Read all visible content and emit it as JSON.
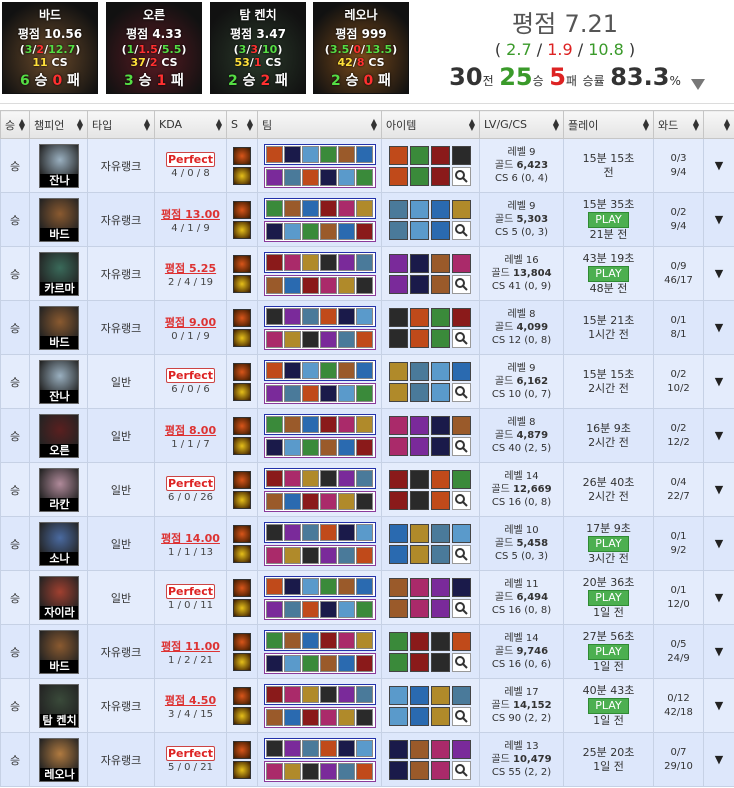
{
  "top_cards": [
    {
      "name": "바드",
      "rating": "평점 10.56",
      "k": "3",
      "d": "2",
      "a": "12.7",
      "cs": "11",
      "wins": "6",
      "losses": "0",
      "bg": "#6a4a2a"
    },
    {
      "name": "오른",
      "rating": "평점 4.33",
      "k": "1",
      "d": "1.5",
      "a": "5.5",
      "cs": "37",
      "cs2": "2",
      "wins": "3",
      "losses": "1",
      "bg": "#5a1a22"
    },
    {
      "name": "탐 켄치",
      "rating": "평점 3.47",
      "k": "3",
      "d": "3",
      "a": "10",
      "cs": "53",
      "cs2": "1",
      "wins": "2",
      "losses": "2",
      "bg": "#2a3a2a"
    },
    {
      "name": "레오나",
      "rating": "평점 999",
      "k": "3.5",
      "d": "0",
      "a": "13.5",
      "cs": "42",
      "cs2": "8",
      "wins": "2",
      "losses": "0",
      "bg": "#7a4a1a"
    }
  ],
  "summary": {
    "rating_label": "평점",
    "rating": "7.21",
    "k": "2.7",
    "d": "1.9",
    "a": "10.8",
    "games": "30",
    "games_unit": "전",
    "wins": "25",
    "wins_unit": "승",
    "losses": "5",
    "losses_unit": "패",
    "winrate_label": "승률",
    "winrate": "83.3",
    "pct": "%"
  },
  "headers": [
    "승",
    "챔피언",
    "타입",
    "KDA",
    "S",
    "팀",
    "아이템",
    "LV/G/CS",
    "플레이",
    "와드",
    ""
  ],
  "rows": [
    {
      "result": "승",
      "champ": "잔나",
      "cbg": "#9ab0c0",
      "type": "자유랭크",
      "kda_label": "Perfect",
      "kda_perfect": true,
      "kda": "4 / 0 / 8",
      "level": "레벨 9",
      "gold": "6,423",
      "cs": "CS 6 (0, 4)",
      "play": "15분 15초",
      "ago": "전",
      "play_btn": false,
      "ward1": "0/3",
      "ward2": "9/4"
    },
    {
      "result": "승",
      "champ": "바드",
      "cbg": "#8a5a30",
      "type": "자유랭크",
      "kda_label": "평점 13.00",
      "kda_perfect": false,
      "kda": "4 / 1 / 9",
      "level": "레벨 9",
      "gold": "5,303",
      "cs": "CS 5 (0, 3)",
      "play": "15분 35초",
      "ago": "21분 전",
      "play_btn": true,
      "ward1": "0/2",
      "ward2": "9/4"
    },
    {
      "result": "승",
      "champ": "카르마",
      "cbg": "#3a6a5a",
      "type": "자유랭크",
      "kda_label": "평점 5.25",
      "kda_perfect": false,
      "kda": "2 / 4 / 19",
      "level": "레벨 16",
      "gold": "13,804",
      "cs": "CS 41 (0, 9)",
      "play": "43분 19초",
      "ago": "48분 전",
      "play_btn": true,
      "ward1": "0/9",
      "ward2": "46/17"
    },
    {
      "result": "승",
      "champ": "바드",
      "cbg": "#8a5a30",
      "type": "자유랭크",
      "kda_label": "평점 9.00",
      "kda_perfect": false,
      "kda": "0 / 1 / 9",
      "level": "레벨 8",
      "gold": "4,099",
      "cs": "CS 12 (0, 8)",
      "play": "15분 21초",
      "ago": "1시간 전",
      "play_btn": false,
      "ward1": "0/1",
      "ward2": "8/1"
    },
    {
      "result": "승",
      "champ": "잔나",
      "cbg": "#9ab0c0",
      "type": "일반",
      "kda_label": "Perfect",
      "kda_perfect": true,
      "kda": "6 / 0 / 6",
      "level": "레벨 9",
      "gold": "6,162",
      "cs": "CS 10 (0, 7)",
      "play": "15분 15초",
      "ago": "2시간 전",
      "play_btn": false,
      "ward1": "0/2",
      "ward2": "10/2"
    },
    {
      "result": "승",
      "champ": "오른",
      "cbg": "#5a2020",
      "type": "일반",
      "kda_label": "평점 8.00",
      "kda_perfect": false,
      "kda": "1 / 1 / 7",
      "level": "레벨 8",
      "gold": "4,879",
      "cs": "CS 40 (2, 5)",
      "play": "16분 9초",
      "ago": "2시간 전",
      "play_btn": false,
      "ward1": "0/2",
      "ward2": "12/2"
    },
    {
      "result": "승",
      "champ": "라칸",
      "cbg": "#b08a9a",
      "type": "일반",
      "kda_label": "Perfect",
      "kda_perfect": true,
      "kda": "6 / 0 / 26",
      "level": "레벨 14",
      "gold": "12,669",
      "cs": "CS 16 (0, 8)",
      "play": "26분 40초",
      "ago": "2시간 전",
      "play_btn": false,
      "ward1": "0/4",
      "ward2": "22/7"
    },
    {
      "result": "승",
      "champ": "소나",
      "cbg": "#4a6aa0",
      "type": "일반",
      "kda_label": "평점 14.00",
      "kda_perfect": false,
      "kda": "1 / 1 / 13",
      "level": "레벨 10",
      "gold": "5,458",
      "cs": "CS 5 (0, 3)",
      "play": "17분 9초",
      "ago": "3시간 전",
      "play_btn": true,
      "ward1": "0/1",
      "ward2": "9/2"
    },
    {
      "result": "승",
      "champ": "자이라",
      "cbg": "#a04030",
      "type": "일반",
      "kda_label": "Perfect",
      "kda_perfect": true,
      "kda": "1 / 0 / 11",
      "level": "레벨 11",
      "gold": "6,494",
      "cs": "CS 16 (0, 8)",
      "play": "20분 36초",
      "ago": "1일 전",
      "play_btn": true,
      "ward1": "0/1",
      "ward2": "12/0"
    },
    {
      "result": "승",
      "champ": "바드",
      "cbg": "#8a5a30",
      "type": "자유랭크",
      "kda_label": "평점 11.00",
      "kda_perfect": false,
      "kda": "1 / 2 / 21",
      "level": "레벨 14",
      "gold": "9,746",
      "cs": "CS 16 (0, 6)",
      "play": "27분 56초",
      "ago": "1일 전",
      "play_btn": true,
      "ward1": "0/5",
      "ward2": "24/9"
    },
    {
      "result": "승",
      "champ": "탐 켄치",
      "cbg": "#3a4a3a",
      "type": "자유랭크",
      "kda_label": "평점 4.50",
      "kda_perfect": false,
      "kda": "3 / 4 / 15",
      "level": "레벨 17",
      "gold": "14,152",
      "cs": "CS 90 (2, 2)",
      "play": "40분 43초",
      "ago": "1일 전",
      "play_btn": true,
      "ward1": "0/12",
      "ward2": "42/18"
    },
    {
      "result": "승",
      "champ": "레오나",
      "cbg": "#b07a40",
      "type": "자유랭크",
      "kda_label": "Perfect",
      "kda_perfect": true,
      "kda": "5 / 0 / 21",
      "level": "레벨 13",
      "gold": "10,479",
      "cs": "CS 55 (2, 2)",
      "play": "25분 20초",
      "ago": "1일 전",
      "play_btn": false,
      "ward1": "0/7",
      "ward2": "29/10"
    }
  ],
  "gold_label": "골드",
  "play_label": "PLAY",
  "colors": {
    "win_bg": "#dde7fb",
    "header_bg": "#eeeeee",
    "perfect": "#d22222",
    "green": "#3a9a2a",
    "red": "#dd2222"
  }
}
